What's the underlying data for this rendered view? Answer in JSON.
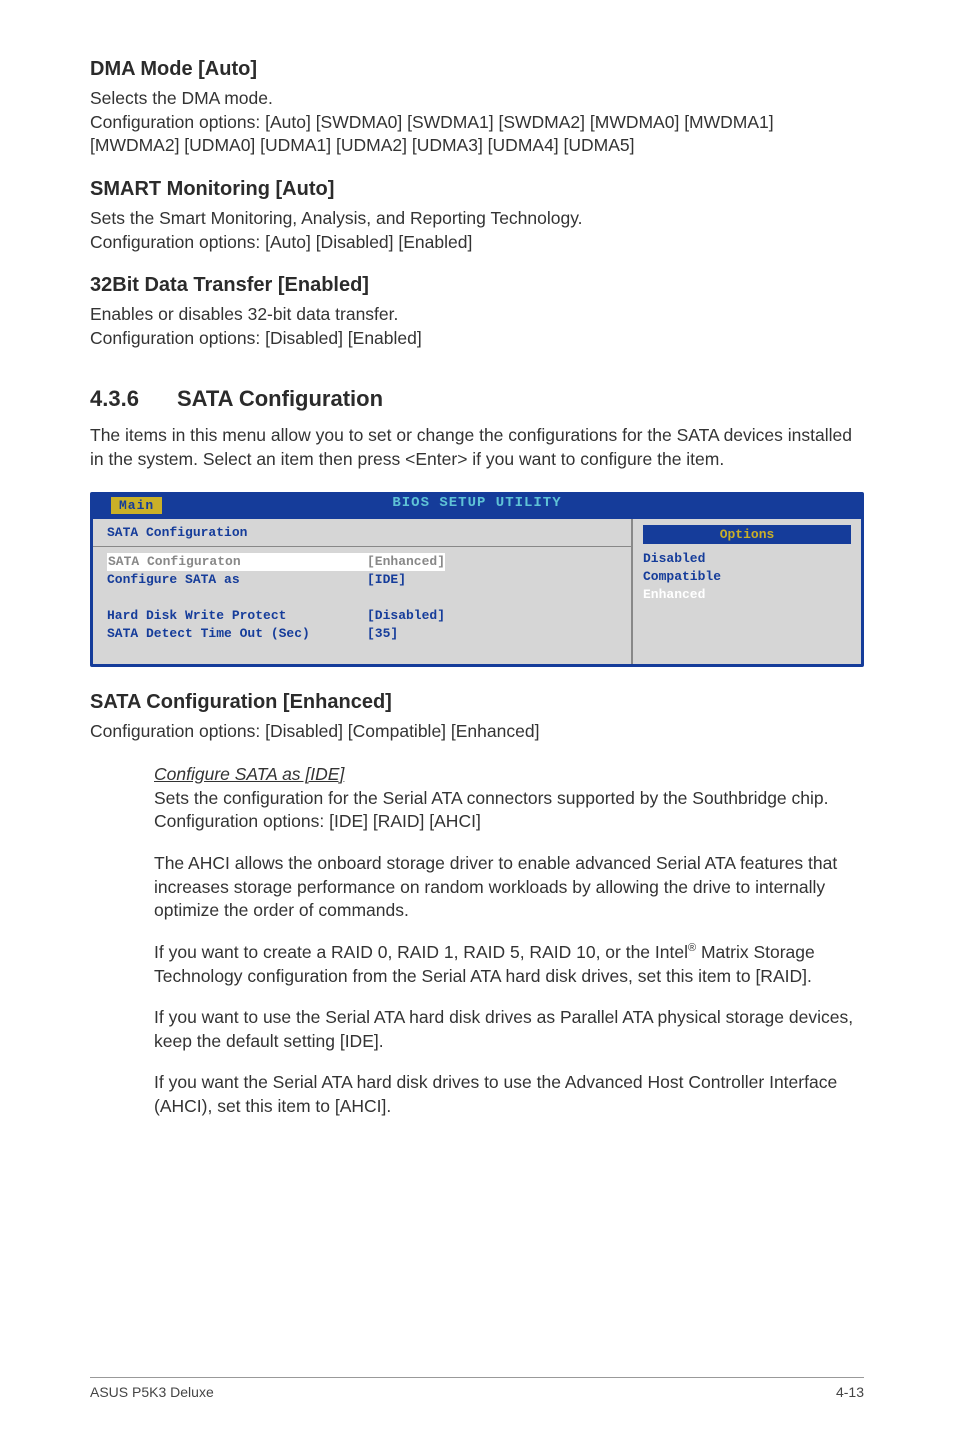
{
  "s1": {
    "title": "DMA Mode [Auto]",
    "l1": "Selects the DMA mode.",
    "l2": "Configuration options: [Auto] [SWDMA0] [SWDMA1] [SWDMA2] [MWDMA0] [MWDMA1] [MWDMA2] [UDMA0] [UDMA1] [UDMA2] [UDMA3] [UDMA4] [UDMA5]"
  },
  "s2": {
    "title": "SMART Monitoring [Auto]",
    "l1": "Sets the Smart Monitoring, Analysis, and Reporting Technology.",
    "l2": "Configuration options: [Auto] [Disabled] [Enabled]"
  },
  "s3": {
    "title": "32Bit Data Transfer [Enabled]",
    "l1": "Enables or disables 32-bit data transfer.",
    "l2": "Configuration options: [Disabled] [Enabled]"
  },
  "h436": {
    "num": "4.3.6",
    "title": "SATA Configuration"
  },
  "h436_intro": "The items in this menu allow you to set or change the configurations for the SATA devices installed in the system. Select an item then press <Enter> if you want to configure the item.",
  "bios": {
    "bar": "BIOS SETUP UTILITY",
    "tab": "Main",
    "heading": "SATA Configuration",
    "rows": [
      {
        "label": "SATA Configuraton",
        "val": "[Enhanced]",
        "sel": true
      },
      {
        "label": " Configure SATA as",
        "val": "[IDE]",
        "sel": false
      },
      {
        "label": "",
        "val": "",
        "sel": false
      },
      {
        "label": "Hard Disk Write Protect",
        "val": "[Disabled]",
        "sel": false
      },
      {
        "label": "SATA Detect Time Out (Sec)",
        "val": "[35]",
        "sel": false
      }
    ],
    "options_title": "Options",
    "options": [
      "Disabled",
      "Compatible",
      "Enhanced"
    ],
    "selected_option_index": 2
  },
  "s4": {
    "title": "SATA Configuration [Enhanced]",
    "l1": "Configuration options: [Disabled] [Compatible] [Enhanced]"
  },
  "sub": {
    "head": "Configure SATA as [IDE]",
    "p1": "Sets the configuration for the Serial ATA connectors supported by the Southbridge chip. Configuration options: [IDE] [RAID] [AHCI]",
    "p2": "The AHCI allows the onboard storage driver to enable advanced Serial ATA features that increases storage performance on random workloads by allowing the drive to internally optimize the order of commands.",
    "p3a": "If you want to create a RAID 0, RAID 1, RAID 5, RAID 10, or the Intel",
    "p3b": " Matrix Storage Technology configuration from the Serial ATA hard disk drives, set this item to [RAID].",
    "p4": "If you want to use the Serial ATA hard disk drives as Parallel ATA physical storage devices, keep the default setting [IDE].",
    "p5": "If you want the Serial ATA hard disk drives to use the Advanced Host Controller Interface (AHCI), set this item to [AHCI]."
  },
  "footer": {
    "left": "ASUS P5K3 Deluxe",
    "right": "4-13"
  }
}
